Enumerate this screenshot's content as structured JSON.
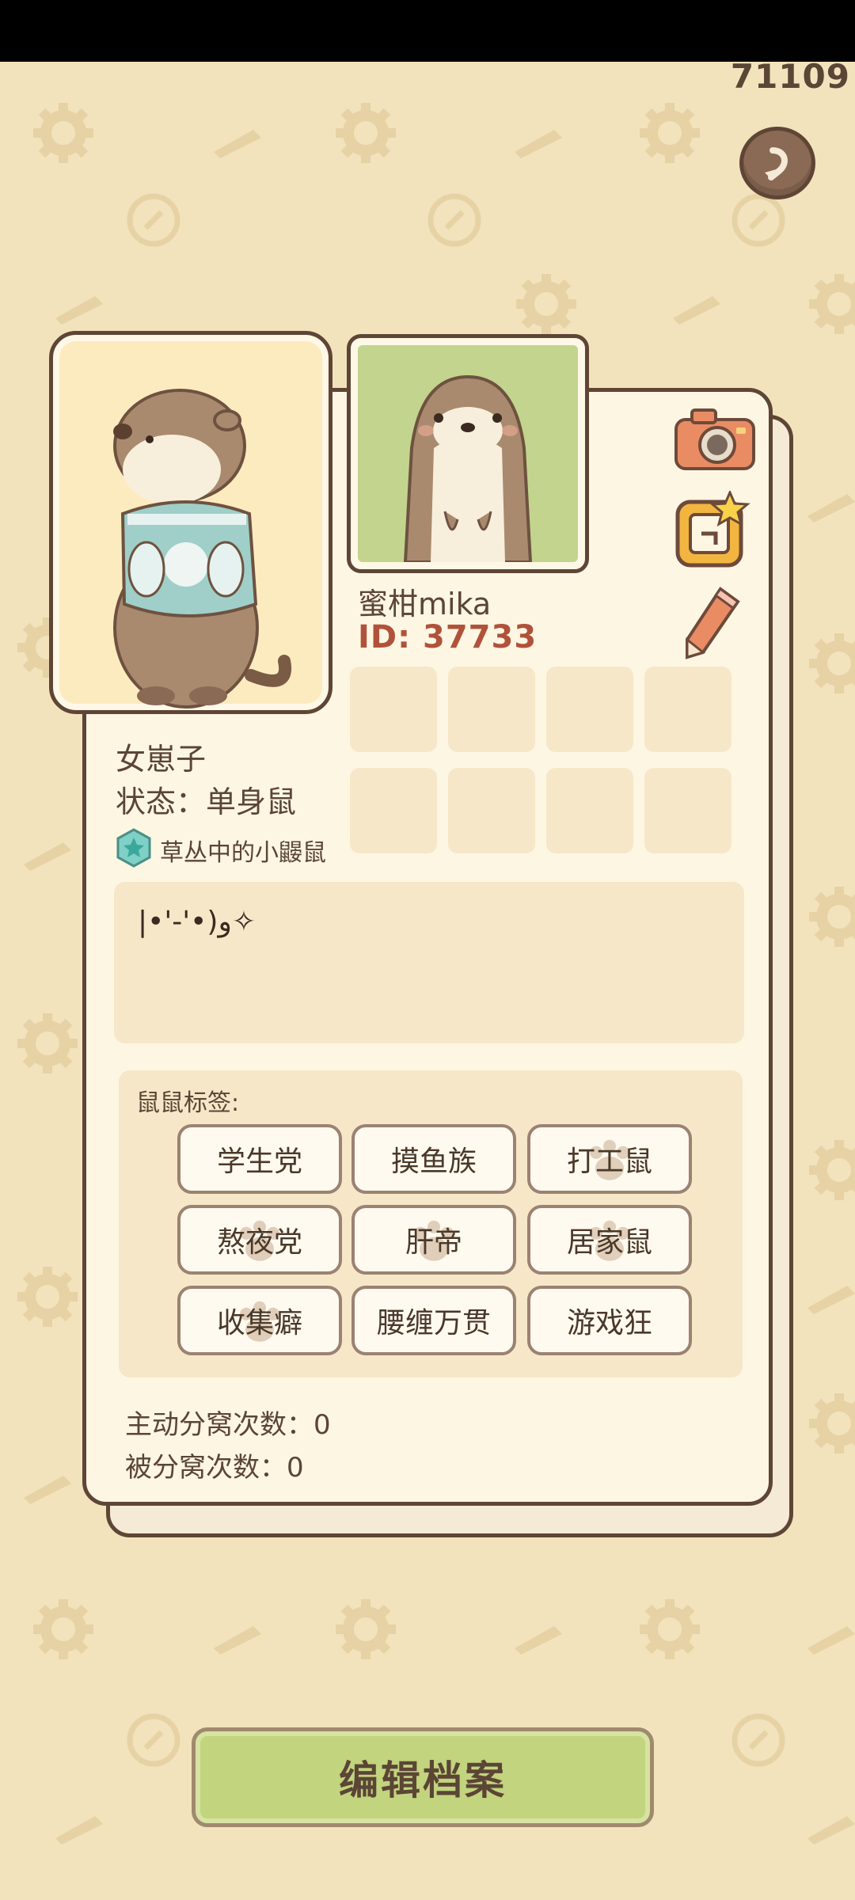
{
  "top": {
    "score": "71109"
  },
  "profile": {
    "nickname": "蜜柑mika",
    "id_text": "ID: 37733",
    "gender": "女崽子",
    "status": "状态：单身鼠",
    "badge": "草丛中的小鼹鼠",
    "bio": "|•'-'•)و✧"
  },
  "tags": {
    "title": "鼠鼠标签:",
    "items": [
      "学生党",
      "摸鱼族",
      "打工鼠",
      "熬夜党",
      "肝帝",
      "居家鼠",
      "收集癖",
      "腰缠万贯",
      "游戏狂"
    ]
  },
  "stats": {
    "active_split": "主动分窝次数：0",
    "passive_split": "被分窝次数：0"
  },
  "actions": {
    "edit_label": "编辑档案"
  },
  "colors": {
    "background": "#f2e3bd",
    "card": "#fdf6e3",
    "border": "#5e4535",
    "id_red": "#b0523b",
    "button_green": "#c2d47e"
  },
  "icons": [
    "back-arrow-icon",
    "camera-icon",
    "sticker-frame-icon",
    "pencil-icon",
    "star-badge-icon",
    "paw-icon"
  ]
}
